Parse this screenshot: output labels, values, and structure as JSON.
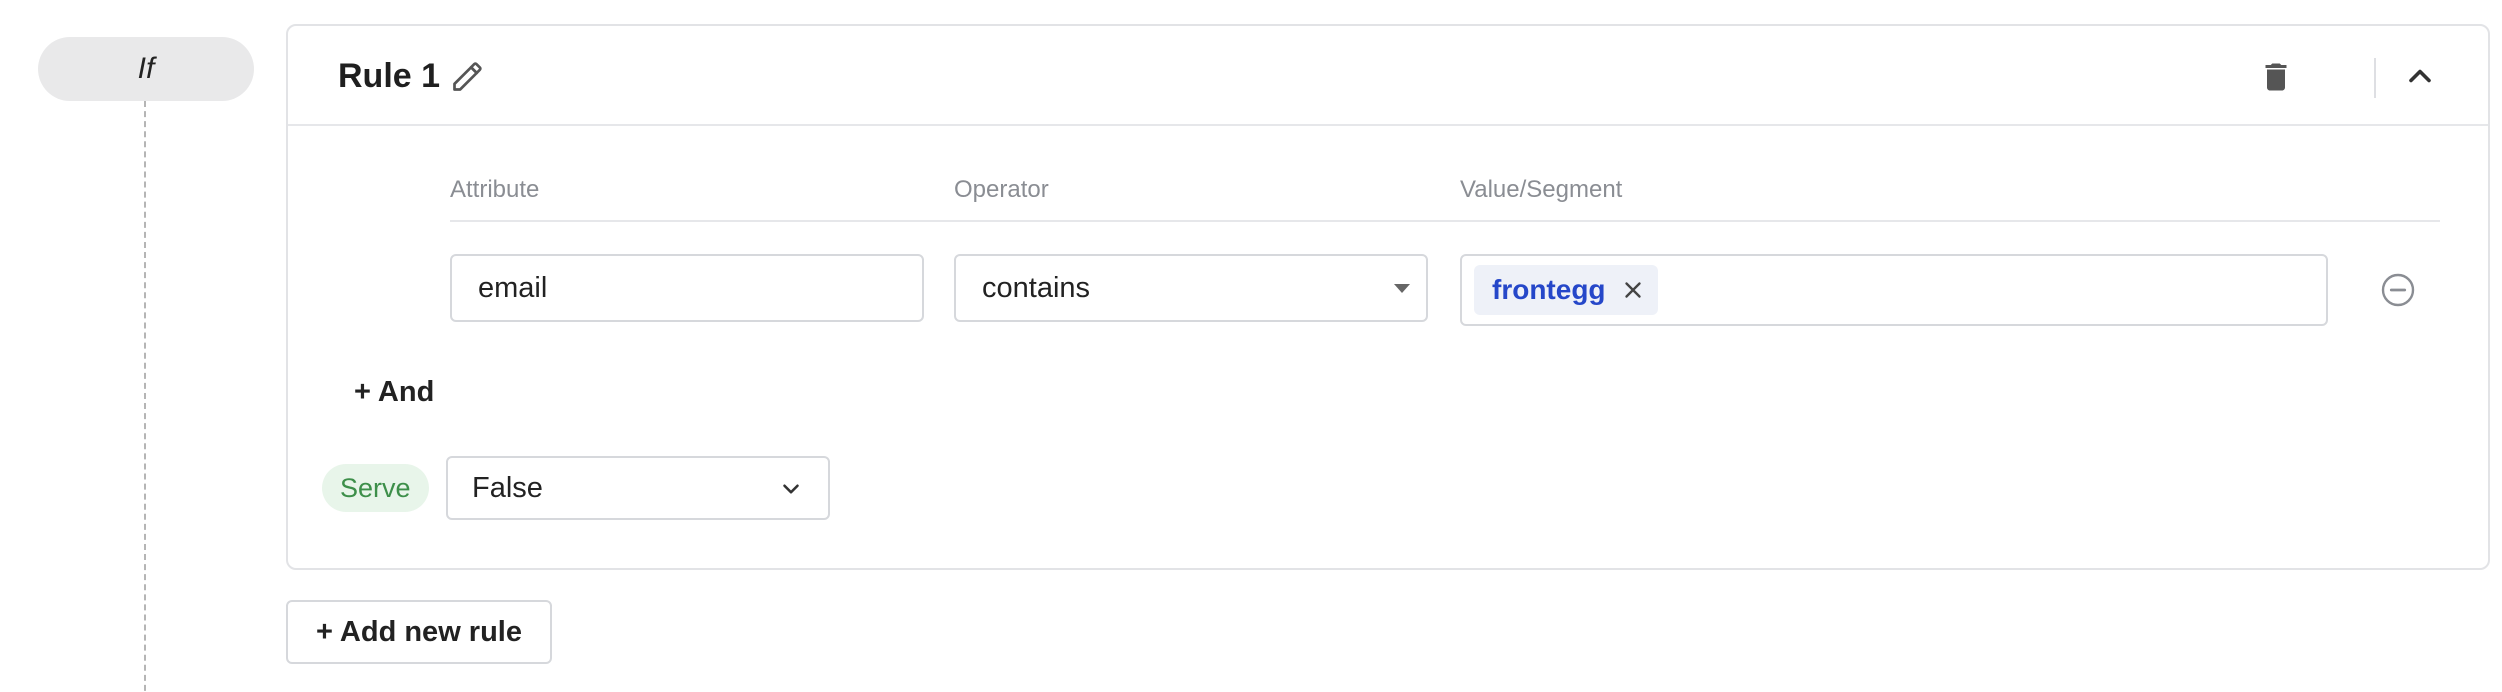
{
  "condition": {
    "label": "If"
  },
  "rule": {
    "title": "Rule 1",
    "columns": {
      "attribute": "Attribute",
      "operator": "Operator",
      "value": "Value/Segment"
    },
    "condition_row": {
      "attribute": "email",
      "operator": "contains",
      "value_chips": [
        "frontegg"
      ]
    },
    "and_label": "+ And",
    "serve": {
      "label": "Serve",
      "value": "False"
    }
  },
  "actions": {
    "add_rule_label": "+ Add new rule"
  },
  "icons": {
    "edit": "pencil-icon",
    "delete": "trash-icon",
    "collapse": "chevron-up-icon",
    "remove_row": "minus-circle-icon",
    "chip_remove": "close-icon",
    "operator_caret": "caret-down-icon",
    "serve_chevron": "chevron-down-icon"
  },
  "colors": {
    "chip_text": "#2547c9",
    "chip_bg": "#eef1f8",
    "serve_text": "#3d8f4a",
    "serve_bg": "#e8f5ea",
    "pill_bg": "#e9e9ea"
  }
}
